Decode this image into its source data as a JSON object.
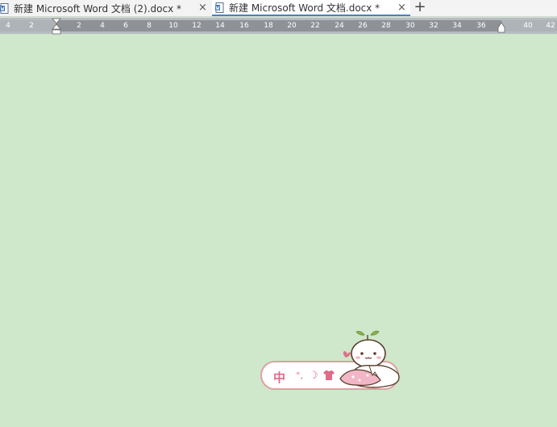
{
  "tabs": [
    {
      "title": "新建 Microsoft Word 文档 (2).docx *",
      "close": "×",
      "icon": "word-doc-icon"
    },
    {
      "title": "新建 Microsoft Word 文档.docx *",
      "close": "×",
      "icon": "word-doc-icon",
      "active": true
    }
  ],
  "new_tab_label": "+",
  "ruler": {
    "numbers": [
      "4",
      "2",
      "2",
      "4",
      "6",
      "8",
      "10",
      "12",
      "14",
      "16",
      "18",
      "20",
      "22",
      "24",
      "26",
      "28",
      "30",
      "32",
      "34",
      "36",
      "40",
      "42"
    ]
  },
  "ime": {
    "mode": "中",
    "punct": "°,",
    "moon": "☽",
    "skin_icon": "shirt-icon",
    "mascot": "sprout-mascot"
  },
  "colors": {
    "page_background": "#cfe7cb",
    "ruler_band": "#8e9297",
    "active_tab_underline": "#4a7ec2",
    "ime_accent": "#e06b8b"
  }
}
